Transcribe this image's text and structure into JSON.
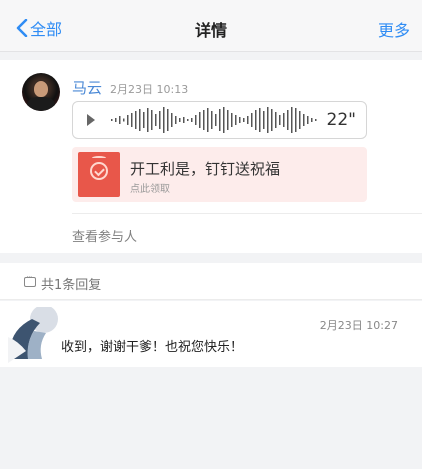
{
  "nav": {
    "back_label": "全部",
    "title": "详情",
    "more_label": "更多"
  },
  "post": {
    "sender_name": "马云",
    "time": "2月23日 10:13",
    "voice": {
      "duration": "22\""
    },
    "red_packet": {
      "title": "开工利是，钉钉送祝福",
      "subtitle": "点此领取"
    },
    "participants_label": "查看参与人"
  },
  "replies": {
    "count_label": "共1条回复",
    "items": [
      {
        "time": "2月23日 10:27",
        "text": "收到，谢谢干爹！也祝您快乐！"
      }
    ]
  },
  "colors": {
    "accent": "#2f8cf4",
    "name": "#4b89d6",
    "red_packet_bg": "#fdeceb",
    "red_packet_icon": "#e8574a"
  }
}
